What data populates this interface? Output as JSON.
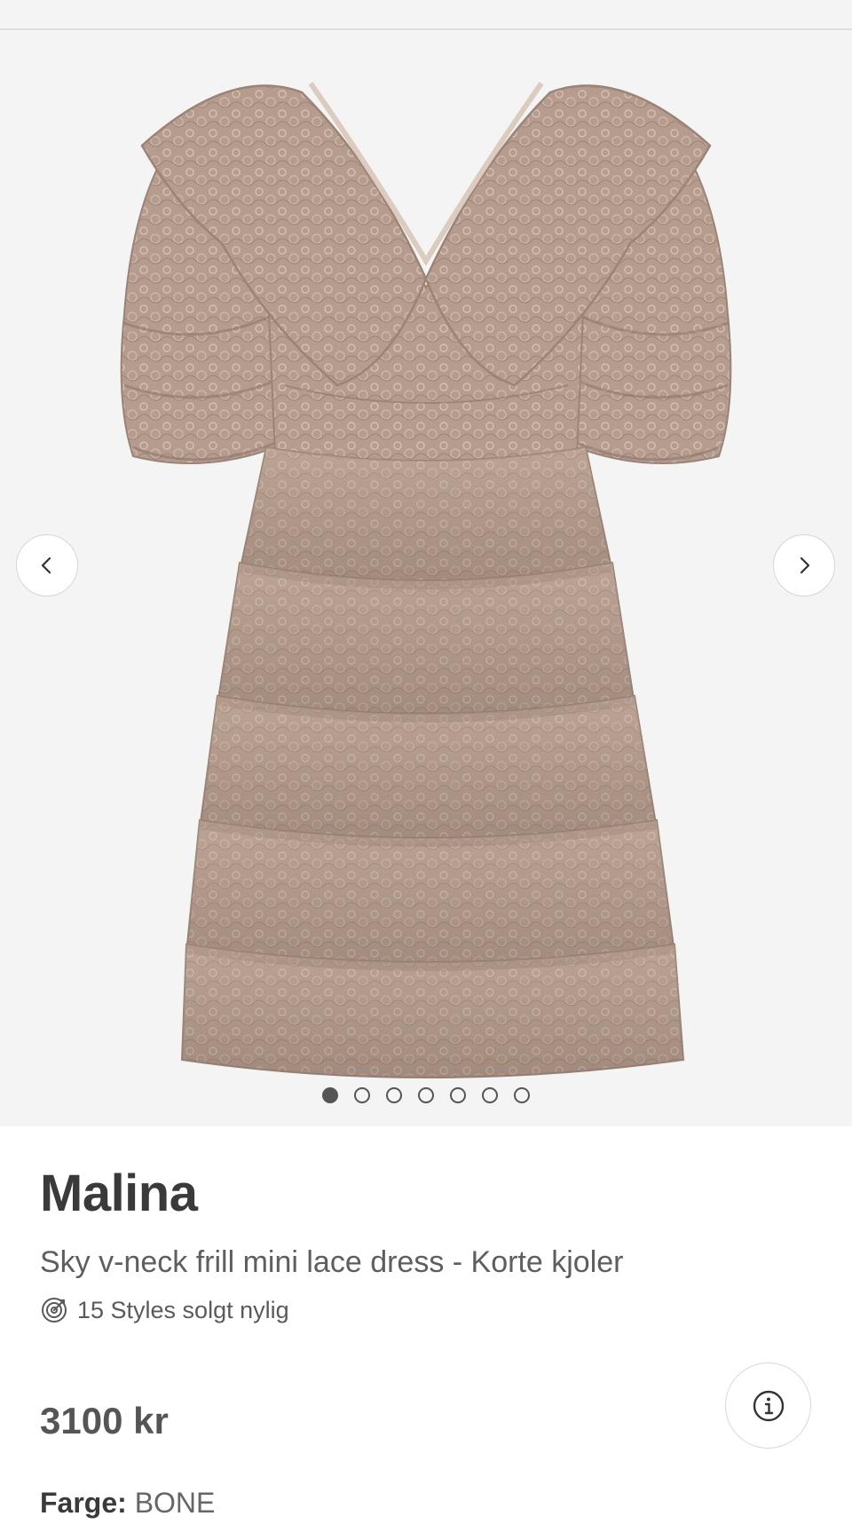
{
  "gallery": {
    "image": "lace-dress-photo",
    "slide_count": 7,
    "active_slide": 1,
    "prev_icon": "chevron-left-icon",
    "next_icon": "chevron-right-icon"
  },
  "product": {
    "brand": "Malina",
    "name": "Sky v-neck frill mini lace dress - Korte kjoler",
    "sold_text": "15 Styles solgt nylig",
    "sold_icon": "target-icon",
    "price": "3100 kr",
    "info_icon": "info-icon",
    "color_label": "Farge:",
    "color_value": "BONE"
  },
  "colors": {
    "dress": "#b39a8c",
    "dress_light": "#d2bcae",
    "dress_dark": "#8e776b",
    "background": "#f4f4f4"
  }
}
